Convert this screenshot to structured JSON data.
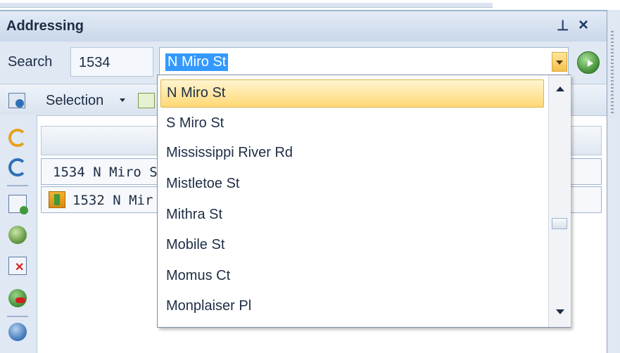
{
  "panel": {
    "title": "Addressing"
  },
  "search": {
    "label": "Search",
    "house_number": "1534",
    "street_value": "N Miro St"
  },
  "toolbar": {
    "selection_label": "Selection"
  },
  "results": {
    "rows": [
      "1534 N Miro S",
      "1532 N Mir"
    ]
  },
  "dropdown": {
    "items": [
      "N Miro St",
      "S Miro St",
      "Mississippi River Rd",
      "Mistletoe St",
      "Mithra St",
      "Mobile St",
      "Momus Ct",
      "Monplaiser Pl"
    ],
    "highlighted_index": 0
  },
  "colors": {
    "highlight": "#ffd874",
    "selection": "#3399ff",
    "panel_bg": "#dfe8f3"
  },
  "icons": [
    "pin-icon",
    "close-icon",
    "combo-arrow-icon",
    "go-icon",
    "selection-icon",
    "refresh-icon",
    "add-row-icon",
    "globe-icon",
    "delete-row-icon",
    "stop-icon",
    "people-icon",
    "scroll-up-icon",
    "scroll-down-icon"
  ]
}
